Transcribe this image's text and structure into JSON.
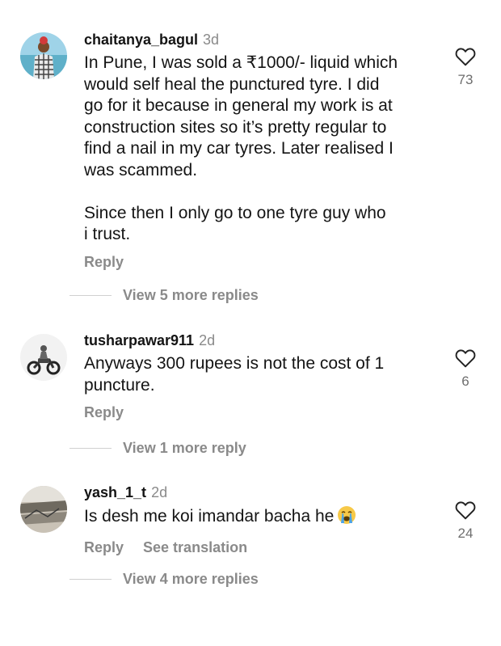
{
  "comments": [
    {
      "username": "chaitanya_bagul",
      "time": "3d",
      "text": "In Pune, I was sold a ₹1000/- liquid which\nwould self heal the punctured tyre. I did\ngo for it because in general my work is at\nconstruction sites so it’s pretty regular to\nfind a nail in my car tyres. Later realised I\nwas scammed.\n\nSince then I only go to one tyre guy who\ni trust.",
      "reply_label": "Reply",
      "likes": "73",
      "view_replies": "View 5 more replies",
      "avatar_icon": "person-outdoors-avatar"
    },
    {
      "username": "tusharpawar911",
      "time": "2d",
      "text": "Anyways 300 rupees is not the cost of 1\npuncture.",
      "reply_label": "Reply",
      "likes": "6",
      "view_replies": "View 1 more reply",
      "avatar_icon": "motorcycle-rider-avatar"
    },
    {
      "username": "yash_1_t",
      "time": "2d",
      "text": "Is desh me koi imandar bacha he",
      "reply_label": "Reply",
      "translate_label": "See translation",
      "likes": "24",
      "view_replies": "View 4 more replies",
      "avatar_icon": "landscape-avatar",
      "emoji": "loudly-crying-face"
    }
  ],
  "colors": {
    "text": "#141414",
    "muted": "#8a8a8a",
    "background": "#ffffff"
  }
}
